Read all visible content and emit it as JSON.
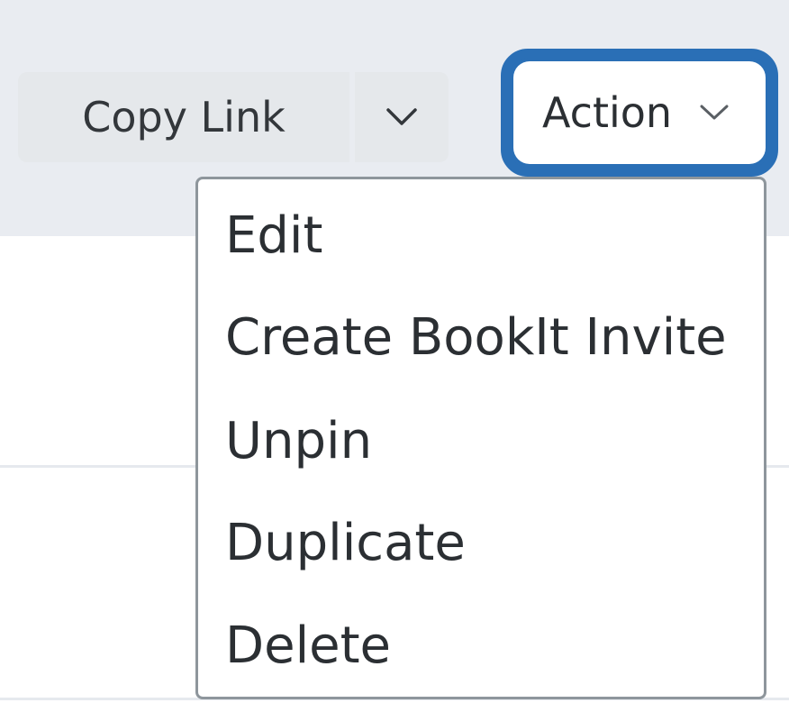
{
  "toolbar": {
    "copy_link_label": "Copy Link",
    "action_label": "Action"
  },
  "icons": {
    "copy_toggle": "chevron-down-icon",
    "action_toggle": "chevron-down-icon"
  },
  "menu": {
    "items": [
      {
        "label": "Edit"
      },
      {
        "label": "Create BookIt Invite"
      },
      {
        "label": "Unpin"
      },
      {
        "label": "Duplicate"
      },
      {
        "label": "Delete"
      }
    ]
  },
  "colors": {
    "accent": "#2a6fb6",
    "toolbar_bg": "#e9ecf1",
    "button_bg": "#e5e8eb",
    "menu_border": "#8e969c",
    "text": "#2b2f33"
  }
}
